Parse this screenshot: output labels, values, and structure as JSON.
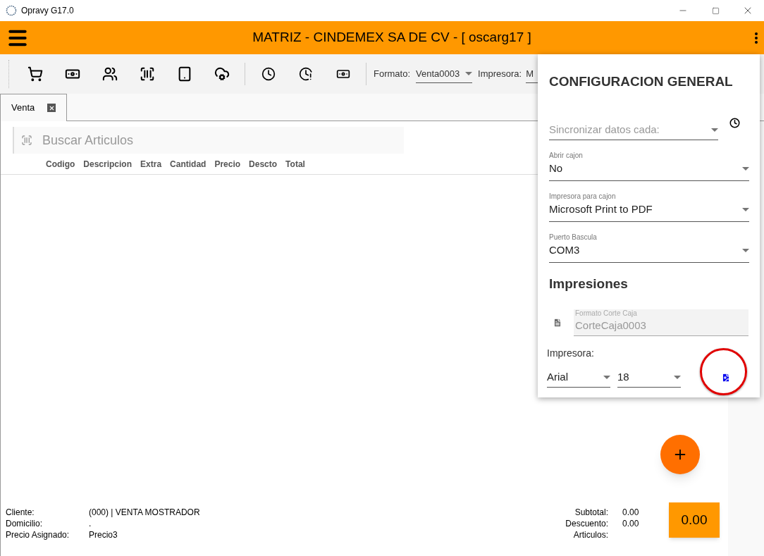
{
  "window": {
    "title": "Opravy G17.0"
  },
  "app_bar": {
    "title": "MATRIZ - CINDEMEX SA DE CV - [ oscarg17 ]"
  },
  "toolbar": {
    "format": {
      "label": "Formato:",
      "value": "Venta0003"
    },
    "printer": {
      "label": "Impresora:",
      "value": "M"
    }
  },
  "tabs": [
    {
      "label": "Venta",
      "selected": true
    }
  ],
  "search": {
    "placeholder": "Buscar Articulos"
  },
  "table": {
    "columns": [
      "Codigo",
      "Descripcion",
      "Extra",
      "Cantidad",
      "Precio",
      "Descto",
      "Total"
    ]
  },
  "customer": [
    {
      "label": "Cliente:",
      "value": "(000) | VENTA MOSTRADOR"
    },
    {
      "label": "Domicilio:",
      "value": "."
    },
    {
      "label": "Precio Asignado:",
      "value": "Precio3"
    }
  ],
  "totals": [
    {
      "label": "Subtotal:",
      "value": "0.00"
    },
    {
      "label": "Descuento:",
      "value": "0.00"
    },
    {
      "label": "Articulos:"
    }
  ],
  "total_button": "0.00",
  "settings_panel": {
    "title": "CONFIGURACION GENERAL",
    "sync": {
      "placeholder": "Sincronizar datos cada:"
    },
    "fields": [
      {
        "label": "Abrir cajon",
        "value": "No"
      },
      {
        "label": "Impresora para cajon",
        "value": "Microsoft Print to PDF"
      },
      {
        "label": "Puerto Bascula",
        "value": "COM3"
      }
    ],
    "section": "Impresiones",
    "cut_format": {
      "label": "Formato Corte Caja",
      "value": "CorteCaja0003",
      "disabled": true
    },
    "printer_label": "Impresora:",
    "font": "Arial",
    "size": "18"
  }
}
